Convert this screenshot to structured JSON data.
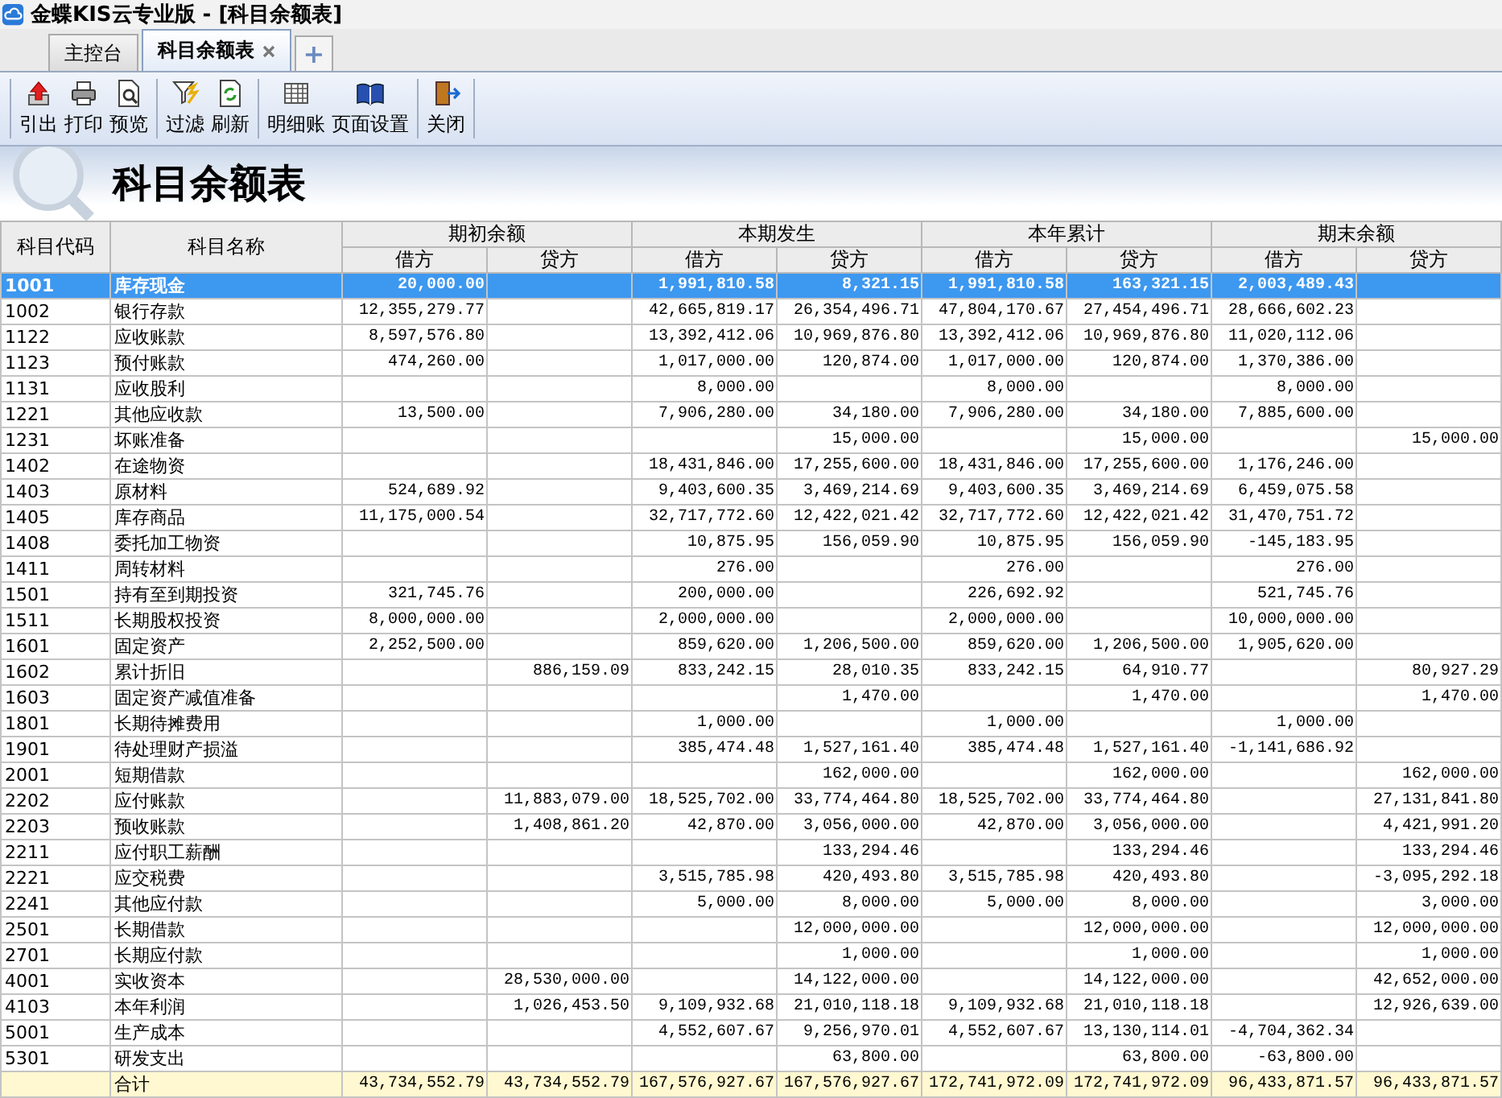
{
  "window": {
    "title": "金蝶KIS云专业版 - [科目余额表]"
  },
  "tabs": [
    {
      "label": "主控台",
      "selected": false,
      "closable": false
    },
    {
      "label": "科目余额表",
      "selected": true,
      "closable": true
    }
  ],
  "new_tab": {
    "label": "+"
  },
  "toolbar": [
    [
      {
        "label": "引出"
      },
      {
        "label": "打印"
      },
      {
        "label": "预览"
      }
    ],
    [
      {
        "label": "过滤"
      },
      {
        "label": "刷新"
      }
    ],
    [
      {
        "label": "明细账"
      },
      {
        "label": "页面设置"
      }
    ],
    [
      {
        "label": "关闭"
      }
    ]
  ],
  "report_title": "科目余额表",
  "table": {
    "columns": [
      "科目代码",
      "科目名称"
    ],
    "groups": [
      {
        "label": "期初余额",
        "sub": [
          "借方",
          "贷方"
        ]
      },
      {
        "label": "本期发生",
        "sub": [
          "借方",
          "贷方"
        ]
      },
      {
        "label": "本年累计",
        "sub": [
          "借方",
          "贷方"
        ]
      },
      {
        "label": "期末余额",
        "sub": [
          "借方",
          "贷方"
        ]
      }
    ],
    "rows": [
      {
        "kind": "account",
        "selected": true,
        "code": "1001",
        "name": "库存现金",
        "opening_debit": "20,000.00",
        "period_debit": "1,991,810.58",
        "period_credit": "8,321.15",
        "ytd_debit": "1,991,810.58",
        "ytd_credit": "163,321.15",
        "closing_debit": "2,003,489.43"
      },
      {
        "kind": "account",
        "selected": false,
        "code": "1002",
        "name": "银行存款",
        "opening_debit": "12,355,279.77",
        "period_debit": "42,665,819.17",
        "period_credit": "26,354,496.71",
        "ytd_debit": "47,804,170.67",
        "ytd_credit": "27,454,496.71",
        "closing_debit": "28,666,602.23"
      },
      {
        "kind": "account",
        "selected": false,
        "code": "1122",
        "name": "应收账款",
        "opening_debit": "8,597,576.80",
        "period_debit": "13,392,412.06",
        "period_credit": "10,969,876.80",
        "ytd_debit": "13,392,412.06",
        "ytd_credit": "10,969,876.80",
        "closing_debit": "11,020,112.06"
      },
      {
        "kind": "account",
        "selected": false,
        "code": "1123",
        "name": "预付账款",
        "opening_debit": "474,260.00",
        "period_debit": "1,017,000.00",
        "period_credit": "120,874.00",
        "ytd_debit": "1,017,000.00",
        "ytd_credit": "120,874.00",
        "closing_debit": "1,370,386.00"
      },
      {
        "kind": "account",
        "selected": false,
        "code": "1131",
        "name": "应收股利",
        "period_debit": "8,000.00",
        "ytd_debit": "8,000.00",
        "closing_debit": "8,000.00"
      },
      {
        "kind": "account",
        "selected": false,
        "code": "1221",
        "name": "其他应收款",
        "opening_debit": "13,500.00",
        "period_debit": "7,906,280.00",
        "period_credit": "34,180.00",
        "ytd_debit": "7,906,280.00",
        "ytd_credit": "34,180.00",
        "closing_debit": "7,885,600.00"
      },
      {
        "kind": "account",
        "selected": false,
        "code": "1231",
        "name": "坏账准备",
        "period_credit": "15,000.00",
        "ytd_credit": "15,000.00",
        "closing_credit": "15,000.00"
      },
      {
        "kind": "account",
        "selected": false,
        "code": "1402",
        "name": "在途物资",
        "period_debit": "18,431,846.00",
        "period_credit": "17,255,600.00",
        "ytd_debit": "18,431,846.00",
        "ytd_credit": "17,255,600.00",
        "closing_debit": "1,176,246.00"
      },
      {
        "kind": "account",
        "selected": false,
        "code": "1403",
        "name": "原材料",
        "opening_debit": "524,689.92",
        "period_debit": "9,403,600.35",
        "period_credit": "3,469,214.69",
        "ytd_debit": "9,403,600.35",
        "ytd_credit": "3,469,214.69",
        "closing_debit": "6,459,075.58"
      },
      {
        "kind": "account",
        "selected": false,
        "code": "1405",
        "name": "库存商品",
        "opening_debit": "11,175,000.54",
        "period_debit": "32,717,772.60",
        "period_credit": "12,422,021.42",
        "ytd_debit": "32,717,772.60",
        "ytd_credit": "12,422,021.42",
        "closing_debit": "31,470,751.72"
      },
      {
        "kind": "account",
        "selected": false,
        "code": "1408",
        "name": "委托加工物资",
        "period_debit": "10,875.95",
        "period_credit": "156,059.90",
        "ytd_debit": "10,875.95",
        "ytd_credit": "156,059.90",
        "closing_debit": "-145,183.95"
      },
      {
        "kind": "account",
        "selected": false,
        "code": "1411",
        "name": "周转材料",
        "period_debit": "276.00",
        "ytd_debit": "276.00",
        "closing_debit": "276.00"
      },
      {
        "kind": "account",
        "selected": false,
        "code": "1501",
        "name": "持有至到期投资",
        "opening_debit": "321,745.76",
        "period_debit": "200,000.00",
        "ytd_debit": "226,692.92",
        "closing_debit": "521,745.76"
      },
      {
        "kind": "account",
        "selected": false,
        "code": "1511",
        "name": "长期股权投资",
        "opening_debit": "8,000,000.00",
        "period_debit": "2,000,000.00",
        "ytd_debit": "2,000,000.00",
        "closing_debit": "10,000,000.00"
      },
      {
        "kind": "account",
        "selected": false,
        "code": "1601",
        "name": "固定资产",
        "opening_debit": "2,252,500.00",
        "period_debit": "859,620.00",
        "period_credit": "1,206,500.00",
        "ytd_debit": "859,620.00",
        "ytd_credit": "1,206,500.00",
        "closing_debit": "1,905,620.00"
      },
      {
        "kind": "account",
        "selected": false,
        "code": "1602",
        "name": "累计折旧",
        "opening_credit": "886,159.09",
        "period_debit": "833,242.15",
        "period_credit": "28,010.35",
        "ytd_debit": "833,242.15",
        "ytd_credit": "64,910.77",
        "closing_credit": "80,927.29"
      },
      {
        "kind": "account",
        "selected": false,
        "code": "1603",
        "name": "固定资产减值准备",
        "period_credit": "1,470.00",
        "ytd_credit": "1,470.00",
        "closing_credit": "1,470.00"
      },
      {
        "kind": "account",
        "selected": false,
        "code": "1801",
        "name": "长期待摊费用",
        "period_debit": "1,000.00",
        "ytd_debit": "1,000.00",
        "closing_debit": "1,000.00"
      },
      {
        "kind": "account",
        "selected": false,
        "code": "1901",
        "name": "待处理财产损溢",
        "period_debit": "385,474.48",
        "period_credit": "1,527,161.40",
        "ytd_debit": "385,474.48",
        "ytd_credit": "1,527,161.40",
        "closing_debit": "-1,141,686.92"
      },
      {
        "kind": "account",
        "selected": false,
        "code": "2001",
        "name": "短期借款",
        "period_credit": "162,000.00",
        "ytd_credit": "162,000.00",
        "closing_credit": "162,000.00"
      },
      {
        "kind": "account",
        "selected": false,
        "code": "2202",
        "name": "应付账款",
        "opening_credit": "11,883,079.00",
        "period_debit": "18,525,702.00",
        "period_credit": "33,774,464.80",
        "ytd_debit": "18,525,702.00",
        "ytd_credit": "33,774,464.80",
        "closing_credit": "27,131,841.80"
      },
      {
        "kind": "account",
        "selected": false,
        "code": "2203",
        "name": "预收账款",
        "opening_credit": "1,408,861.20",
        "period_debit": "42,870.00",
        "period_credit": "3,056,000.00",
        "ytd_debit": "42,870.00",
        "ytd_credit": "3,056,000.00",
        "closing_credit": "4,421,991.20"
      },
      {
        "kind": "account",
        "selected": false,
        "code": "2211",
        "name": "应付职工薪酬",
        "period_credit": "133,294.46",
        "ytd_credit": "133,294.46",
        "closing_credit": "133,294.46"
      },
      {
        "kind": "account",
        "selected": false,
        "code": "2221",
        "name": "应交税费",
        "period_debit": "3,515,785.98",
        "period_credit": "420,493.80",
        "ytd_debit": "3,515,785.98",
        "ytd_credit": "420,493.80",
        "closing_credit": "-3,095,292.18"
      },
      {
        "kind": "account",
        "selected": false,
        "code": "2241",
        "name": "其他应付款",
        "period_debit": "5,000.00",
        "period_credit": "8,000.00",
        "ytd_debit": "5,000.00",
        "ytd_credit": "8,000.00",
        "closing_credit": "3,000.00"
      },
      {
        "kind": "account",
        "selected": false,
        "code": "2501",
        "name": "长期借款",
        "period_credit": "12,000,000.00",
        "ytd_credit": "12,000,000.00",
        "closing_credit": "12,000,000.00"
      },
      {
        "kind": "account",
        "selected": false,
        "code": "2701",
        "name": "长期应付款",
        "period_credit": "1,000.00",
        "ytd_credit": "1,000.00",
        "closing_credit": "1,000.00"
      },
      {
        "kind": "account",
        "selected": false,
        "code": "4001",
        "name": "实收资本",
        "opening_credit": "28,530,000.00",
        "period_credit": "14,122,000.00",
        "ytd_credit": "14,122,000.00",
        "closing_credit": "42,652,000.00"
      },
      {
        "kind": "account",
        "selected": false,
        "code": "4103",
        "name": "本年利润",
        "opening_credit": "1,026,453.50",
        "period_debit": "9,109,932.68",
        "period_credit": "21,010,118.18",
        "ytd_debit": "9,109,932.68",
        "ytd_credit": "21,010,118.18",
        "closing_credit": "12,926,639.00"
      },
      {
        "kind": "account",
        "selected": false,
        "code": "5001",
        "name": "生产成本",
        "period_debit": "4,552,607.67",
        "period_credit": "9,256,970.01",
        "ytd_debit": "4,552,607.67",
        "ytd_credit": "13,130,114.01",
        "closing_debit": "-4,704,362.34"
      },
      {
        "kind": "account",
        "selected": false,
        "code": "5301",
        "name": "研发支出",
        "period_credit": "63,800.00",
        "ytd_credit": "63,800.00",
        "closing_debit": "-63,800.00"
      },
      {
        "kind": "total",
        "selected": false,
        "name": "合计",
        "opening_debit": "43,734,552.79",
        "opening_credit": "43,734,552.79",
        "period_debit": "167,576,927.67",
        "period_credit": "167,576,927.67",
        "ytd_debit": "172,741,972.09",
        "ytd_credit": "172,741,972.09",
        "closing_debit": "96,433,871.57",
        "closing_credit": "96,433,871.57"
      }
    ]
  }
}
